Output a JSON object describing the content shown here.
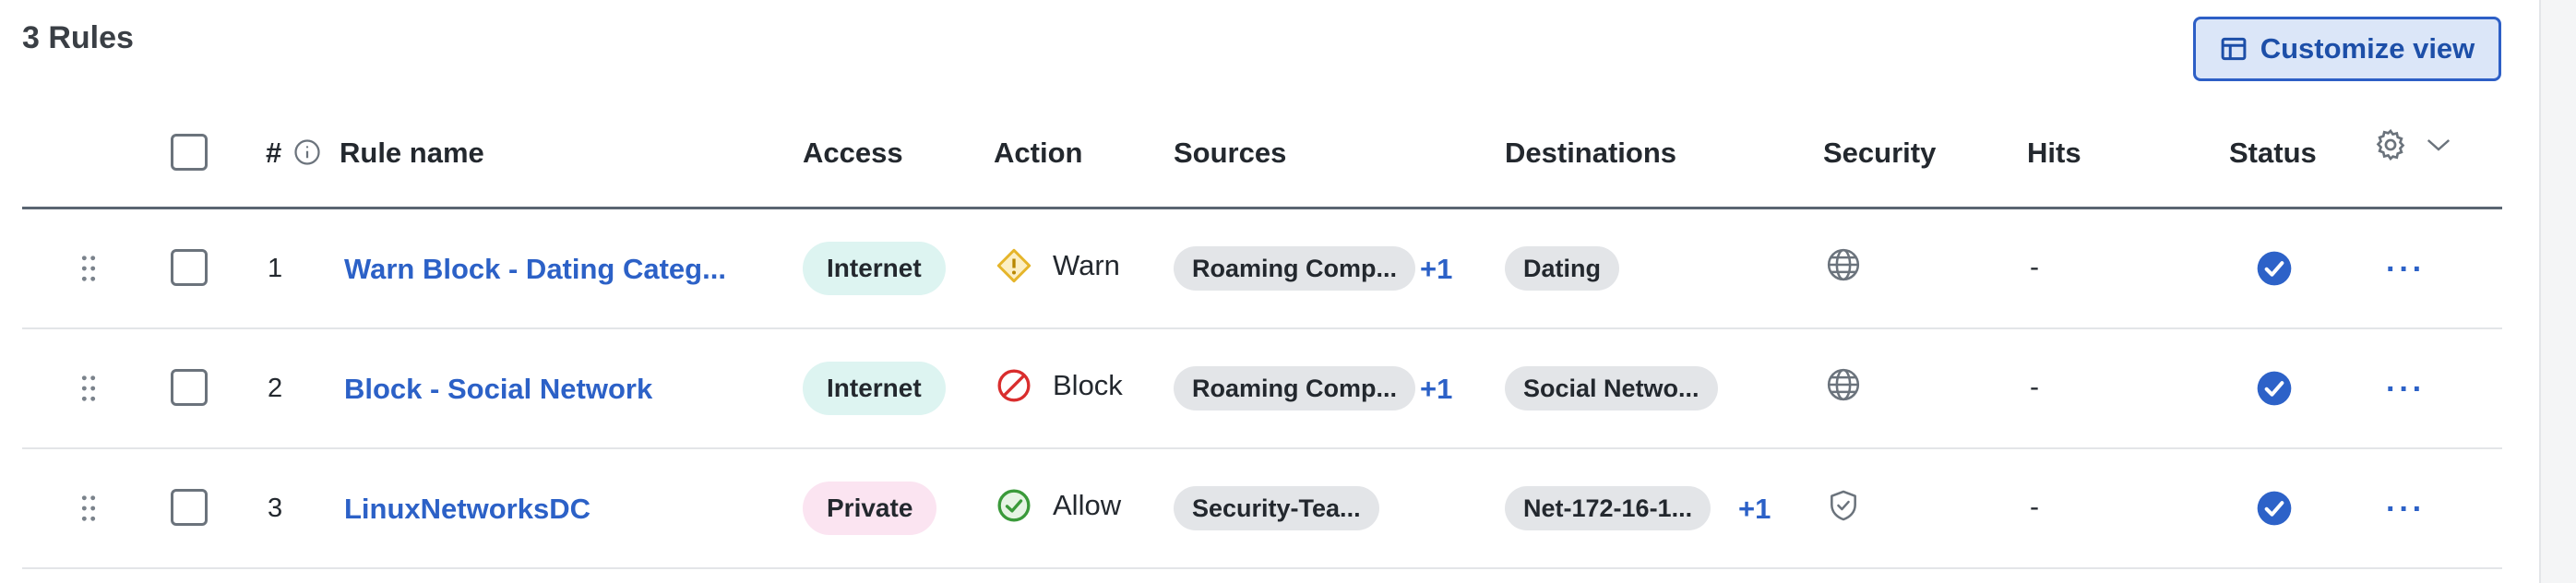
{
  "page": {
    "title": "3 Rules",
    "customize_label": "Customize view"
  },
  "columns": {
    "index": "#",
    "rule_name": "Rule name",
    "access": "Access",
    "action": "Action",
    "sources": "Sources",
    "destinations": "Destinations",
    "security": "Security",
    "hits": "Hits",
    "status": "Status"
  },
  "colors": {
    "link": "#2c61c7",
    "internet_pill": "#ddf4f1",
    "private_pill": "#fbe4f1",
    "warn": "#e5b52a",
    "block": "#d92d2d",
    "allow": "#3a9a3a",
    "status_ok": "#2d62c8"
  },
  "rows": [
    {
      "index": "1",
      "name": "Warn Block - Dating Categ...",
      "access": "Internet",
      "action": "Warn",
      "action_icon": "warn-icon",
      "source": "Roaming Comp...",
      "source_more": "+1",
      "destination": "Dating",
      "destination_more": "",
      "security_icon": "globe-icon",
      "hits": "-",
      "status_icon": "check-circle-icon"
    },
    {
      "index": "2",
      "name": "Block - Social Network",
      "access": "Internet",
      "action": "Block",
      "action_icon": "block-icon",
      "source": "Roaming Comp...",
      "source_more": "+1",
      "destination": "Social Netwo...",
      "destination_more": "",
      "security_icon": "globe-icon",
      "hits": "-",
      "status_icon": "check-circle-icon"
    },
    {
      "index": "3",
      "name": "LinuxNetworksDC",
      "access": "Private",
      "action": "Allow",
      "action_icon": "allow-icon",
      "source": "Security-Tea...",
      "source_more": "",
      "destination": "Net-172-16-1...",
      "destination_more": "+1",
      "security_icon": "shield-check-icon",
      "hits": "-",
      "status_icon": "check-circle-icon"
    }
  ]
}
